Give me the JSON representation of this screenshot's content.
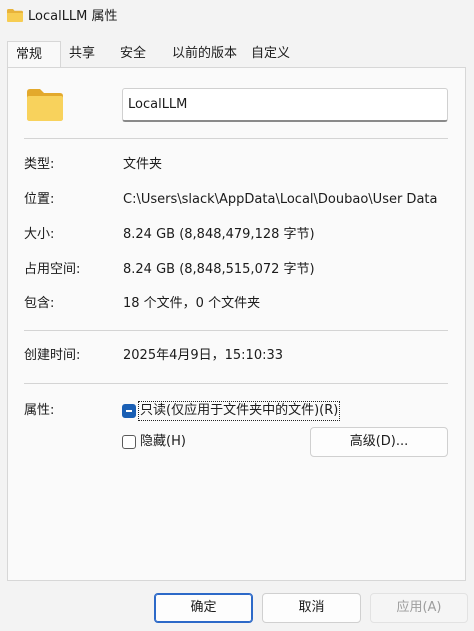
{
  "window": {
    "title": "LocalLLM 属性",
    "icon": "folder-icon"
  },
  "tabs": [
    {
      "label": "常规",
      "active": true
    },
    {
      "label": "共享"
    },
    {
      "label": "安全"
    },
    {
      "label": "以前的版本"
    },
    {
      "label": "自定义"
    }
  ],
  "general": {
    "folder_name": "LocalLLM",
    "type_label": "类型:",
    "type_value": "文件夹",
    "location_label": "位置:",
    "location_value": "C:\\Users\\slack\\AppData\\Local\\Doubao\\User Data",
    "size_label": "大小:",
    "size_value": "8.24 GB (8,848,479,128 字节)",
    "disk_label": "占用空间:",
    "disk_value": "8.24 GB (8,848,515,072 字节)",
    "contains_label": "包含:",
    "contains_value": "18 个文件，0 个文件夹",
    "created_label": "创建时间:",
    "created_value": "2025年4月9日，15:10:33",
    "attributes_label": "属性:",
    "readonly_label": "只读(仅应用于文件夹中的文件)(R)",
    "hidden_label": "隐藏(H)",
    "advanced_label": "高级(D)..."
  },
  "buttons": {
    "ok": "确定",
    "cancel": "取消",
    "apply": "应用(A)"
  },
  "colors": {
    "accent": "#1a5fb4",
    "folder": "#f5c542"
  }
}
